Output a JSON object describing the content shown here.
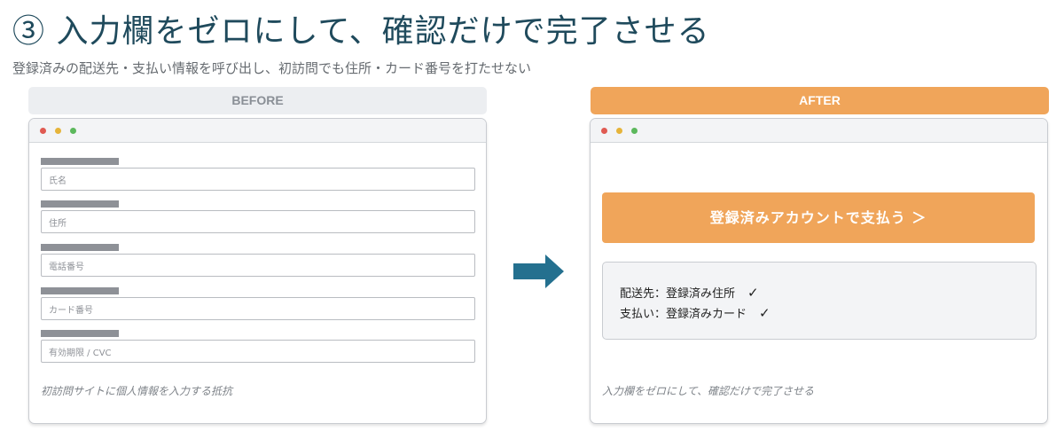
{
  "title": "③ 入力欄をゼロにして、確認だけで完了させる",
  "subtitle": "登録済みの配送先・支払い情報を呼び出し、初訪問でも住所・カード番号を打たせない",
  "before": {
    "header": "BEFORE",
    "fields": [
      {
        "placeholder": "氏名"
      },
      {
        "placeholder": "住所"
      },
      {
        "placeholder": "電話番号"
      },
      {
        "placeholder": "カード番号"
      },
      {
        "placeholder": "有効期限 / CVC"
      }
    ],
    "caption": "初訪問サイトに個人情報を入力する抵抗"
  },
  "after": {
    "header": "AFTER",
    "pay_button": "登録済みアカウントで支払う ＞",
    "info": [
      {
        "text": "配送先：登録済み住所",
        "check": "✓"
      },
      {
        "text": "支払い：登録済みカード",
        "check": "✓"
      }
    ],
    "caption": "入力欄をゼロにして、確認だけで完了させる"
  },
  "colors": {
    "accent": "#f0a55a",
    "arrow": "#24708f",
    "title": "#1f4a5c"
  }
}
